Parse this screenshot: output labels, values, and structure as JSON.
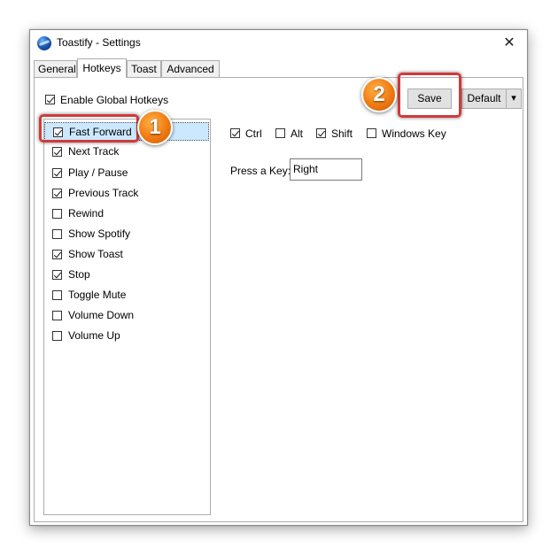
{
  "window": {
    "title": "Toastify - Settings",
    "close_symbol": "✕"
  },
  "tabs": [
    {
      "label": "General"
    },
    {
      "label": "Hotkeys"
    },
    {
      "label": "Toast"
    },
    {
      "label": "Advanced"
    }
  ],
  "hotkeys": {
    "enable_global_label": "Enable Global Hotkeys",
    "enable_global_checked": true,
    "save_label": "Save",
    "default_label": "Default",
    "dropdown_arrow": "▾",
    "actions": [
      {
        "label": "Fast Forward",
        "checked": true,
        "selected": true
      },
      {
        "label": "Next Track",
        "checked": true
      },
      {
        "label": "Play / Pause",
        "checked": true
      },
      {
        "label": "Previous Track",
        "checked": true
      },
      {
        "label": "Rewind",
        "checked": false
      },
      {
        "label": "Show Spotify",
        "checked": false
      },
      {
        "label": "Show Toast",
        "checked": true
      },
      {
        "label": "Stop",
        "checked": true
      },
      {
        "label": "Toggle Mute",
        "checked": false
      },
      {
        "label": "Volume Down",
        "checked": false
      },
      {
        "label": "Volume Up",
        "checked": false
      }
    ],
    "modifiers": [
      {
        "label": "Ctrl",
        "checked": true
      },
      {
        "label": "Alt",
        "checked": false
      },
      {
        "label": "Shift",
        "checked": true
      },
      {
        "label": "Windows Key",
        "checked": false
      }
    ],
    "press_key_label": "Press a Key:",
    "press_key_value": "Right"
  },
  "annotations": [
    {
      "number": "1"
    },
    {
      "number": "2"
    }
  ],
  "colors": {
    "callout_border": "#d23a3a",
    "badge_orange": "#f07a12",
    "selection": "#cce8ff"
  }
}
